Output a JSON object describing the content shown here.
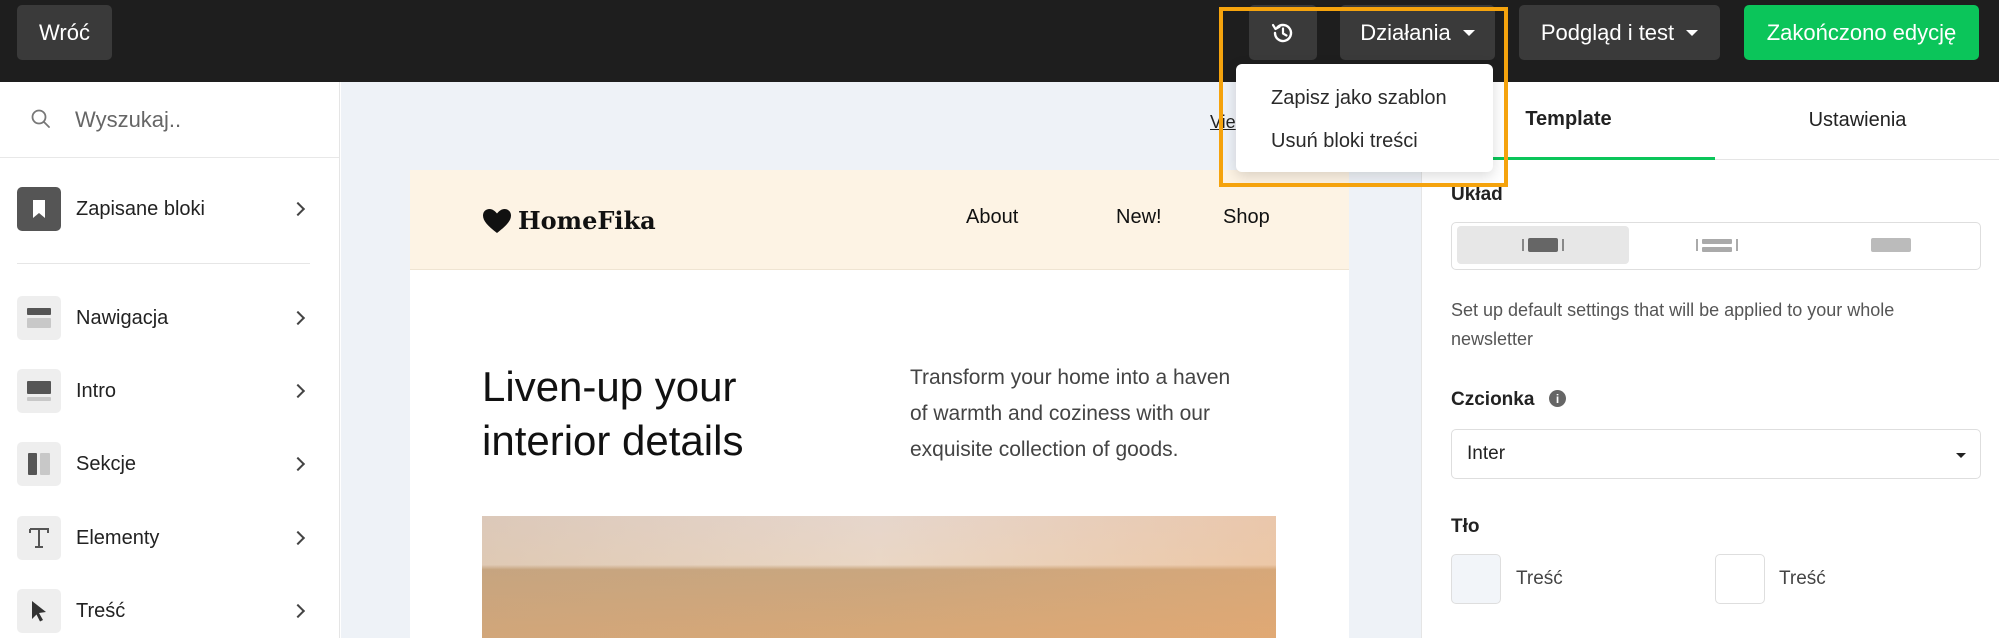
{
  "topbar": {
    "back_label": "Wróć",
    "history_icon": "history-icon",
    "actions_label": "Działania",
    "preview_label": "Podgląd i test",
    "done_label": "Zakończono edycję",
    "done_color": "#0bc55a"
  },
  "actions_menu": {
    "items": [
      "Zapisz jako szablon",
      "Usuń bloki treści"
    ],
    "highlight_color": "#f5a30d"
  },
  "sidebar": {
    "search_placeholder": "Wyszukaj..",
    "saved": {
      "label": "Zapisane bloki",
      "icon": "bookmark-icon"
    },
    "items": [
      {
        "label": "Nawigacja",
        "icon": "navigation-block-icon"
      },
      {
        "label": "Intro",
        "icon": "intro-block-icon"
      },
      {
        "label": "Sekcje",
        "icon": "sections-block-icon"
      },
      {
        "label": "Elementy",
        "icon": "text-t-icon"
      },
      {
        "label": "Treść",
        "icon": "cursor-arrow-icon"
      }
    ]
  },
  "canvas": {
    "view_link": "Vie",
    "email": {
      "logo_text": "HomeFika",
      "nav": [
        "About",
        "New!",
        "Shop"
      ],
      "hero_title_lines": [
        "Liven-up your",
        "interior details"
      ],
      "hero_text_lines": [
        "Transform your home into a haven",
        "of warmth and coziness with our",
        "exquisite collection of goods."
      ]
    }
  },
  "panel": {
    "tabs": [
      "Template",
      "Ustawienia"
    ],
    "active_tab": "Template",
    "layout_label": "Układ",
    "description": "Set up default settings that will be applied to your whole newsletter",
    "font_label": "Czcionka",
    "font_value": "Inter",
    "background_label": "Tło",
    "background_swatches": [
      {
        "label": "Treść",
        "color": "#f2f5f9"
      },
      {
        "label": "Treść",
        "color": "#ffffff"
      }
    ]
  }
}
